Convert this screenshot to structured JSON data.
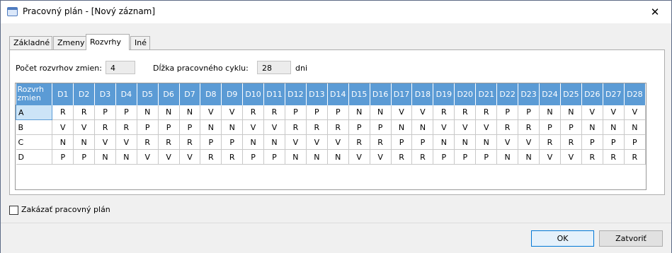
{
  "window": {
    "title": "Pracovný plán - [Nový záznam]",
    "close_glyph": "✕"
  },
  "tabs": [
    "Základné",
    "Zmeny",
    "Rozvrhy",
    "Iné"
  ],
  "active_tab": "Rozvrhy",
  "fields": {
    "count_label": "Počet rozvrhov zmien:",
    "count_value": "4",
    "cycle_label": "Dĺžka pracovného cyklu:",
    "cycle_value": "28",
    "cycle_unit": "dni"
  },
  "grid": {
    "corner_line1": "Rozvrh",
    "corner_line2": "zmien",
    "columns": [
      "D1",
      "D2",
      "D3",
      "D4",
      "D5",
      "D6",
      "D7",
      "D8",
      "D9",
      "D10",
      "D11",
      "D12",
      "D13",
      "D14",
      "D15",
      "D16",
      "D17",
      "D18",
      "D19",
      "D20",
      "D21",
      "D22",
      "D23",
      "D24",
      "D25",
      "D26",
      "D27",
      "D28"
    ],
    "rows": [
      {
        "name": "A",
        "cells": [
          "R",
          "R",
          "P",
          "P",
          "N",
          "N",
          "N",
          "V",
          "V",
          "R",
          "R",
          "P",
          "P",
          "P",
          "N",
          "N",
          "V",
          "V",
          "R",
          "R",
          "R",
          "P",
          "P",
          "N",
          "N",
          "V",
          "V",
          "V"
        ]
      },
      {
        "name": "B",
        "cells": [
          "V",
          "V",
          "R",
          "R",
          "P",
          "P",
          "P",
          "N",
          "N",
          "V",
          "V",
          "R",
          "R",
          "R",
          "P",
          "P",
          "N",
          "N",
          "V",
          "V",
          "V",
          "R",
          "R",
          "P",
          "P",
          "N",
          "N",
          "N"
        ]
      },
      {
        "name": "C",
        "cells": [
          "N",
          "N",
          "V",
          "V",
          "R",
          "R",
          "R",
          "P",
          "P",
          "N",
          "N",
          "V",
          "V",
          "V",
          "R",
          "R",
          "P",
          "P",
          "N",
          "N",
          "N",
          "V",
          "V",
          "R",
          "R",
          "P",
          "P",
          "P"
        ]
      },
      {
        "name": "D",
        "cells": [
          "P",
          "P",
          "N",
          "N",
          "V",
          "V",
          "V",
          "R",
          "R",
          "P",
          "P",
          "N",
          "N",
          "N",
          "V",
          "V",
          "R",
          "R",
          "P",
          "P",
          "P",
          "N",
          "N",
          "V",
          "V",
          "R",
          "R",
          "R"
        ]
      }
    ]
  },
  "disable_label": "Zakázať pracovný plán",
  "buttons": {
    "ok": "OK",
    "close": "Zatvoriť"
  }
}
